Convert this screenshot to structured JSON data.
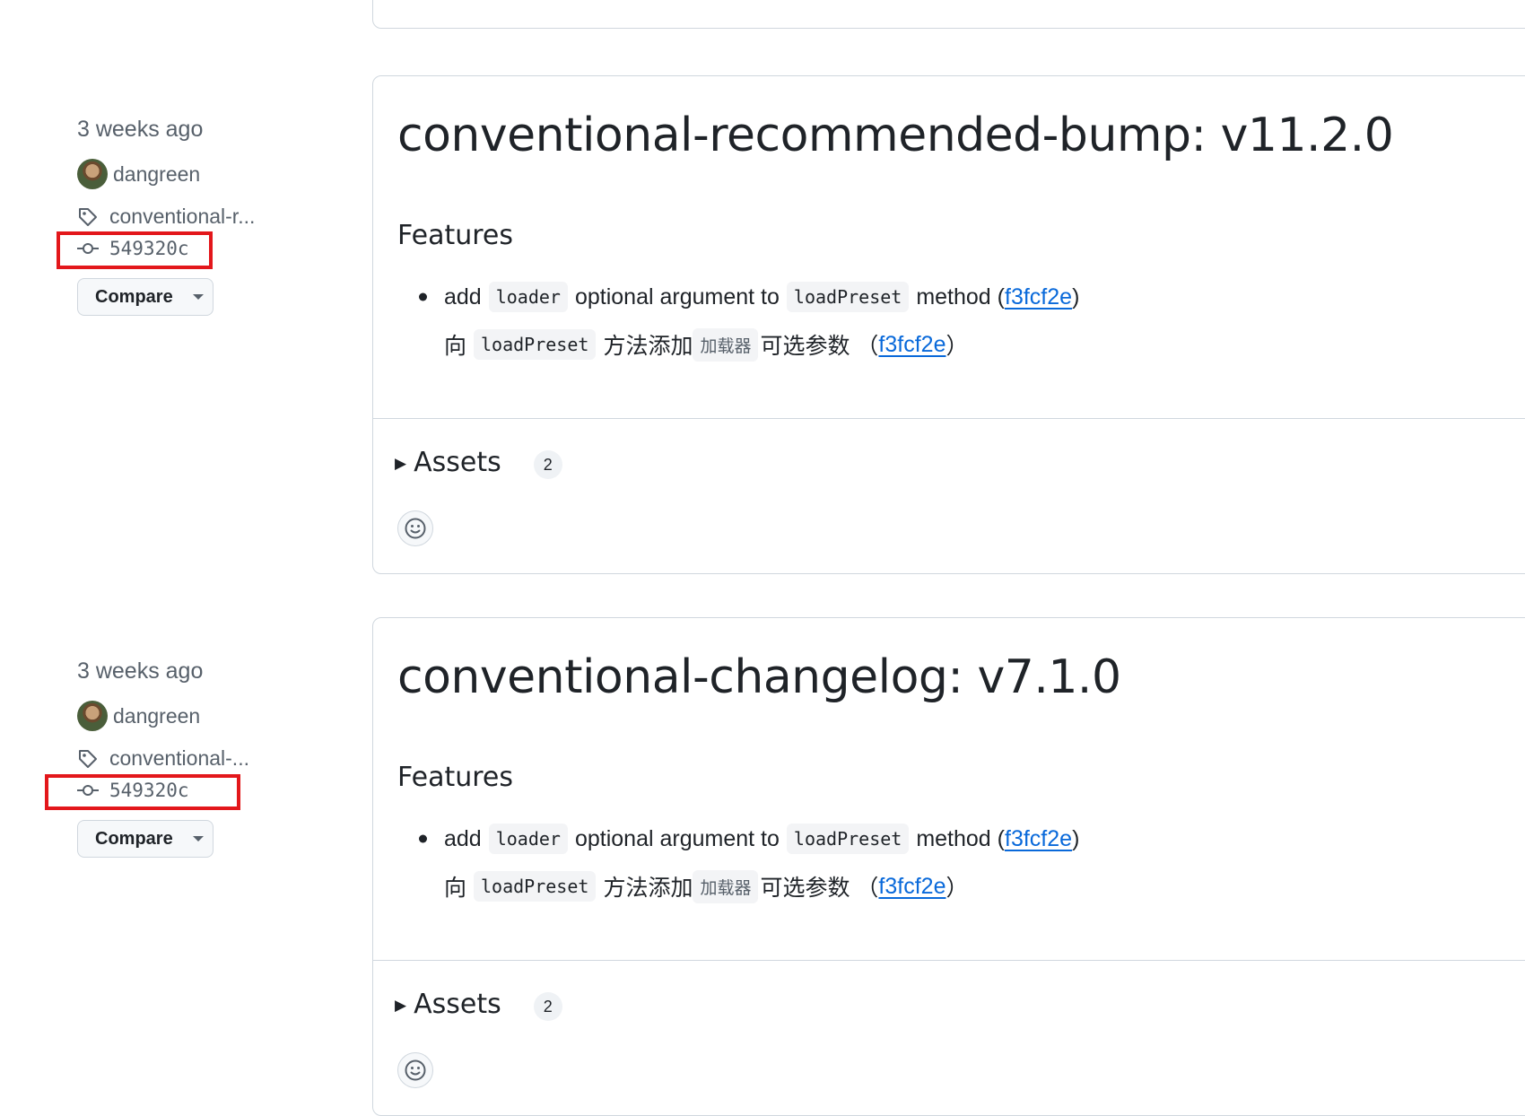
{
  "colors": {
    "link": "#0969da",
    "highlight": "#e3171b",
    "muted": "#57606a",
    "border": "#d0d7de"
  },
  "releases": [
    {
      "time": "3 weeks ago",
      "author": "dangreen",
      "tag": "conventional-r...",
      "commit": "549320c",
      "compare_label": "Compare",
      "title": "conventional-recommended-bump: v11.2.0",
      "features_heading": "Features",
      "feature_en": {
        "pre": "add",
        "code1": "loader",
        "mid": "optional argument to",
        "code2": "loadPreset",
        "post": "method (",
        "link": "f3fcf2e",
        "close": ")"
      },
      "feature_zh": {
        "pre": "向",
        "code1": "loadPreset",
        "mid": "方法添加",
        "code2": "加载器",
        "post": "可选参数 （",
        "link": "f3fcf2e",
        "close": "）"
      },
      "assets_label": "Assets",
      "assets_count": "2",
      "reaction_icon": "smiley-icon"
    },
    {
      "time": "3 weeks ago",
      "author": "dangreen",
      "tag": "conventional-...",
      "commit": "549320c",
      "compare_label": "Compare",
      "title": "conventional-changelog: v7.1.0",
      "features_heading": "Features",
      "feature_en": {
        "pre": "add",
        "code1": "loader",
        "mid": "optional argument to",
        "code2": "loadPreset",
        "post": "method (",
        "link": "f3fcf2e",
        "close": ")"
      },
      "feature_zh": {
        "pre": "向",
        "code1": "loadPreset",
        "mid": "方法添加",
        "code2": "加载器",
        "post": "可选参数 （",
        "link": "f3fcf2e",
        "close": "）"
      },
      "assets_label": "Assets",
      "assets_count": "2",
      "reaction_icon": "smiley-icon"
    }
  ]
}
